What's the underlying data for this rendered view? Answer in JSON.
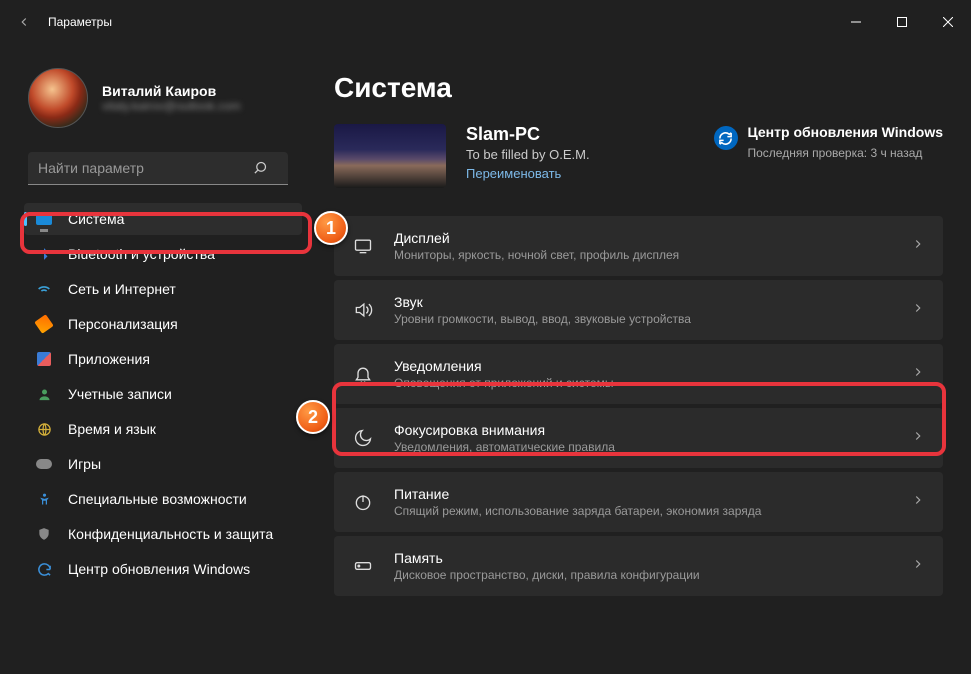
{
  "titlebar": {
    "title": "Параметры"
  },
  "profile": {
    "name": "Виталий Каиров",
    "email": "vitaly.kairov@outlook.com"
  },
  "search": {
    "placeholder": "Найти параметр"
  },
  "sidebar": {
    "items": [
      {
        "label": "Система"
      },
      {
        "label": "Bluetooth и устройства"
      },
      {
        "label": "Сеть и Интернет"
      },
      {
        "label": "Персонализация"
      },
      {
        "label": "Приложения"
      },
      {
        "label": "Учетные записи"
      },
      {
        "label": "Время и язык"
      },
      {
        "label": "Игры"
      },
      {
        "label": "Специальные возможности"
      },
      {
        "label": "Конфиденциальность и защита"
      },
      {
        "label": "Центр обновления Windows"
      }
    ]
  },
  "page": {
    "title": "Система",
    "pc_name": "Slam-PC",
    "pc_oem": "To be filled by O.E.M.",
    "pc_rename": "Переименовать",
    "update_title": "Центр обновления Windows",
    "update_sub": "Последняя проверка: 3 ч назад"
  },
  "rows": [
    {
      "title": "Дисплей",
      "sub": "Мониторы, яркость, ночной свет, профиль дисплея"
    },
    {
      "title": "Звук",
      "sub": "Уровни громкости, вывод, ввод, звуковые устройства"
    },
    {
      "title": "Уведомления",
      "sub": "Оповещения от приложений и системы"
    },
    {
      "title": "Фокусировка внимания",
      "sub": "Уведомления, автоматические правила"
    },
    {
      "title": "Питание",
      "sub": "Спящий режим, использование заряда батареи, экономия заряда"
    },
    {
      "title": "Память",
      "sub": "Дисковое пространство, диски, правила конфигурации"
    }
  ],
  "callouts": {
    "one": "1",
    "two": "2"
  }
}
